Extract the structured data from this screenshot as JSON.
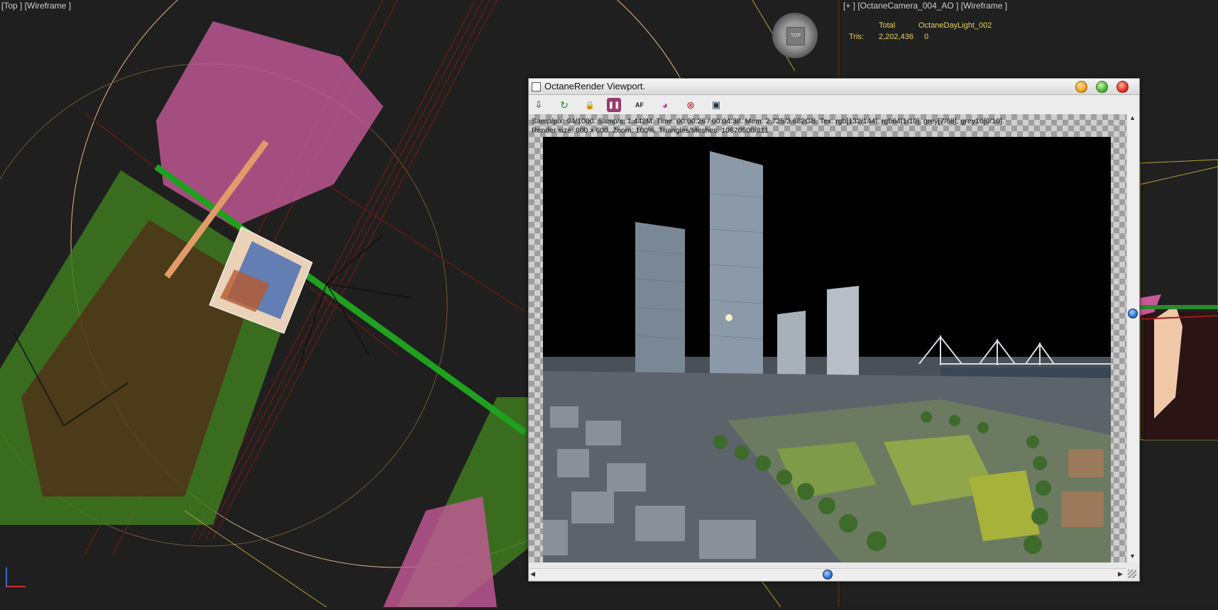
{
  "viewport_top": {
    "label": "[Top ] [Wireframe ]"
  },
  "viewcube": {
    "label": "TOP"
  },
  "viewport_camera": {
    "label": "[+ ] [OctaneCamera_004_AO ] [Wireframe ]",
    "stats": {
      "col_total": "Total",
      "col_object": "OctaneDayLight_002",
      "tris_label": "Tris:",
      "tris_total": "2,202,436",
      "tris_object": "0"
    }
  },
  "octane_window": {
    "title": "OctaneRender Viewport.",
    "toolbar": [
      {
        "name": "export-icon",
        "glyph": "⇩"
      },
      {
        "name": "restart-icon",
        "glyph": "↻"
      },
      {
        "name": "lock-icon",
        "glyph": "🔒"
      },
      {
        "name": "pause-icon",
        "glyph": "❚❚"
      },
      {
        "name": "autofocus-icon",
        "glyph": "AF"
      },
      {
        "name": "color-icon",
        "glyph": "◕"
      },
      {
        "name": "region-icon",
        "glyph": "⊗"
      },
      {
        "name": "display-icon",
        "glyph": "▣"
      }
    ],
    "info_line1": "Samp/pix: 94/1000.   Samp/s: 1.442M.   Time: 00:00:26 / 00:04:38.   Mem: 2.725/3.682GB.   Tex: rgb[132/144], rgb64[1/10], grey[7/68], grey16[0/10].",
    "info_line2": "Render size: 800 x 600.   Zoom: 100%.   Triangles/Meshes: 10670500/811"
  },
  "colors": {
    "accent_pause": "#9c3a6e",
    "stats_text": "#e8d25a",
    "tree_green": "#4e9a2a",
    "tree_pink": "#d86aa8",
    "road_green": "#1fa01f",
    "wire_red": "#7a1a1a"
  }
}
